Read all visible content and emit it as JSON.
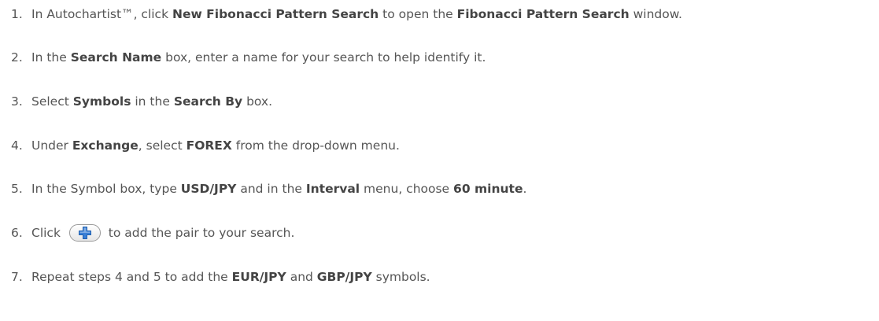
{
  "steps": [
    {
      "num": "1.",
      "parts": [
        {
          "t": "In Autochartist™, click "
        },
        {
          "t": "New Fibonacci Pattern Search",
          "b": true
        },
        {
          "t": " to open the "
        },
        {
          "t": "Fibonacci Pattern Search",
          "b": true
        },
        {
          "t": " window."
        }
      ]
    },
    {
      "num": "2.",
      "parts": [
        {
          "t": "In the "
        },
        {
          "t": "Search Name",
          "b": true
        },
        {
          "t": " box, enter a name for your search to help identify it."
        }
      ]
    },
    {
      "num": "3.",
      "parts": [
        {
          "t": "Select "
        },
        {
          "t": "Symbols",
          "b": true
        },
        {
          "t": " in the "
        },
        {
          "t": "Search By",
          "b": true
        },
        {
          "t": " box."
        }
      ]
    },
    {
      "num": "4.",
      "parts": [
        {
          "t": "Under "
        },
        {
          "t": "Exchange",
          "b": true
        },
        {
          "t": ", select "
        },
        {
          "t": "FOREX",
          "b": true
        },
        {
          "t": " from the drop-down menu."
        }
      ]
    },
    {
      "num": "5.",
      "parts": [
        {
          "t": "In the Symbol box, type "
        },
        {
          "t": "USD/JPY",
          "b": true
        },
        {
          "t": " and in the "
        },
        {
          "t": "Interval",
          "b": true
        },
        {
          "t": " menu, choose "
        },
        {
          "t": "60 minute",
          "b": true
        },
        {
          "t": "."
        }
      ]
    },
    {
      "num": "6.",
      "parts": [
        {
          "t": "Click "
        },
        {
          "icon": "add-plus-icon"
        },
        {
          "t": " to add the pair to your search."
        }
      ]
    },
    {
      "num": "7.",
      "parts": [
        {
          "t": "Repeat steps 4 and 5 to add the "
        },
        {
          "t": "EUR/JPY",
          "b": true
        },
        {
          "t": " and "
        },
        {
          "t": "GBP/JPY",
          "b": true
        },
        {
          "t": " symbols."
        }
      ]
    }
  ],
  "colors": {
    "text": "#555555",
    "bold_text": "#444444",
    "plus_fill": "#3a7fd6",
    "plus_stroke": "#1f5fae"
  }
}
